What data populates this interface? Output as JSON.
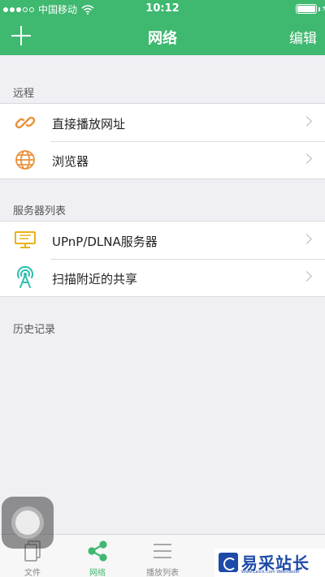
{
  "status_bar": {
    "carrier": "中国移动",
    "time": "10:12"
  },
  "nav": {
    "title": "网络",
    "edit_label": "编辑",
    "add_icon": "plus-icon"
  },
  "sections": {
    "remote": {
      "header": "远程",
      "items": [
        {
          "label": "直接播放网址",
          "icon": "link-icon"
        },
        {
          "label": "浏览器",
          "icon": "globe-icon"
        }
      ]
    },
    "servers": {
      "header": "服务器列表",
      "items": [
        {
          "label": "UPnP/DLNA服务器",
          "icon": "monitor-icon"
        },
        {
          "label": "扫描附近的共享",
          "icon": "antenna-icon"
        }
      ]
    },
    "history": {
      "header": "历史记录"
    }
  },
  "tabs": [
    {
      "label": "文件",
      "icon": "files-icon",
      "active": false
    },
    {
      "label": "网络",
      "icon": "share-icon",
      "active": true
    },
    {
      "label": "播放列表",
      "icon": "list-icon",
      "active": false
    }
  ],
  "watermark": {
    "text": "易采站长站",
    "sub": "Www.Easck.Com Webmaster"
  },
  "colors": {
    "accent": "#3fb870",
    "link_icon": "#e8923a",
    "globe_icon": "#e8923a",
    "monitor_icon": "#e8b21a",
    "antenna_icon": "#2bbfae"
  }
}
